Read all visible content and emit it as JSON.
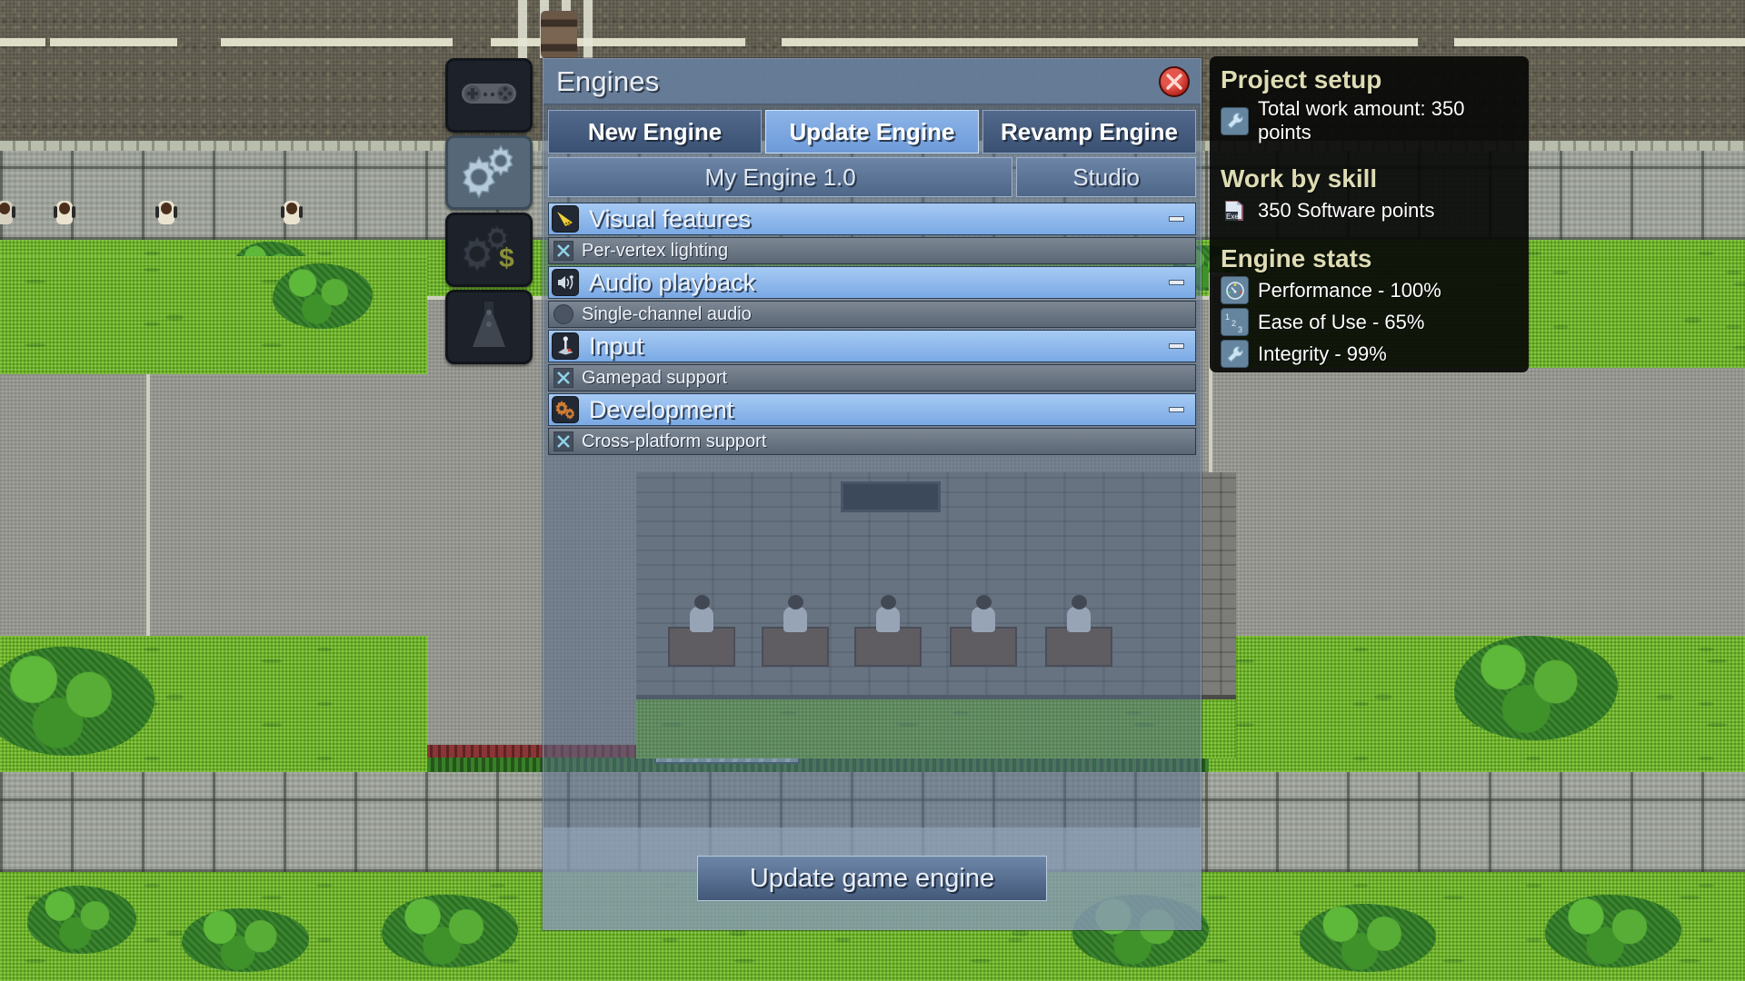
{
  "window": {
    "title": "Engines",
    "close_icon": "close-x-icon"
  },
  "tabs": [
    {
      "label": "New Engine",
      "active": false
    },
    {
      "label": "Update Engine",
      "active": true
    },
    {
      "label": "Revamp Engine",
      "active": false
    }
  ],
  "subtabs": [
    {
      "label": "My Engine 1.0"
    },
    {
      "label": "Studio"
    }
  ],
  "feature_categories": [
    {
      "name": "Visual features",
      "icon": "lighting-beam-icon",
      "collapse_symbol": "-",
      "features": [
        {
          "label": "Per-vertex lighting",
          "state": "checked",
          "marker": "x-mark-icon"
        }
      ]
    },
    {
      "name": "Audio playback",
      "icon": "speaker-note-icon",
      "collapse_symbol": "-",
      "features": [
        {
          "label": "Single-channel audio",
          "state": "unchecked",
          "marker": "circle-icon"
        }
      ]
    },
    {
      "name": "Input",
      "icon": "joystick-icon",
      "collapse_symbol": "-",
      "features": [
        {
          "label": "Gamepad support",
          "state": "checked",
          "marker": "x-mark-icon"
        }
      ]
    },
    {
      "name": "Development",
      "icon": "gears-icon",
      "collapse_symbol": "-",
      "features": [
        {
          "label": "Cross-platform support",
          "state": "checked",
          "marker": "x-mark-icon"
        }
      ]
    }
  ],
  "footer": {
    "submit_label": "Update game engine"
  },
  "info_panel": {
    "project_setup": {
      "title": "Project setup",
      "rows": [
        {
          "icon": "wrench-icon",
          "text": "Total work amount: 350 points"
        }
      ]
    },
    "work_by_skill": {
      "title": "Work by skill",
      "rows": [
        {
          "icon": "software-exe-icon",
          "text": "350 Software points"
        }
      ]
    },
    "engine_stats": {
      "title": "Engine stats",
      "rows": [
        {
          "icon": "gauge-icon",
          "text": "Performance - 100%"
        },
        {
          "icon": "numbers-icon",
          "text": "Ease of Use - 65%"
        },
        {
          "icon": "wrench-icon",
          "text": "Integrity - 99%"
        }
      ]
    }
  },
  "toolbar": [
    {
      "icon": "gamepad-icon",
      "active": false
    },
    {
      "icon": "gears-settings-icon",
      "active": true
    },
    {
      "icon": "gear-money-icon",
      "active": false
    },
    {
      "icon": "chart-icon",
      "active": false
    }
  ],
  "colors": {
    "accent_blue": "#7aa9e4",
    "panel_dark": "#080907",
    "heading_cream": "#dedcb4",
    "close_red": "#b8251c"
  }
}
